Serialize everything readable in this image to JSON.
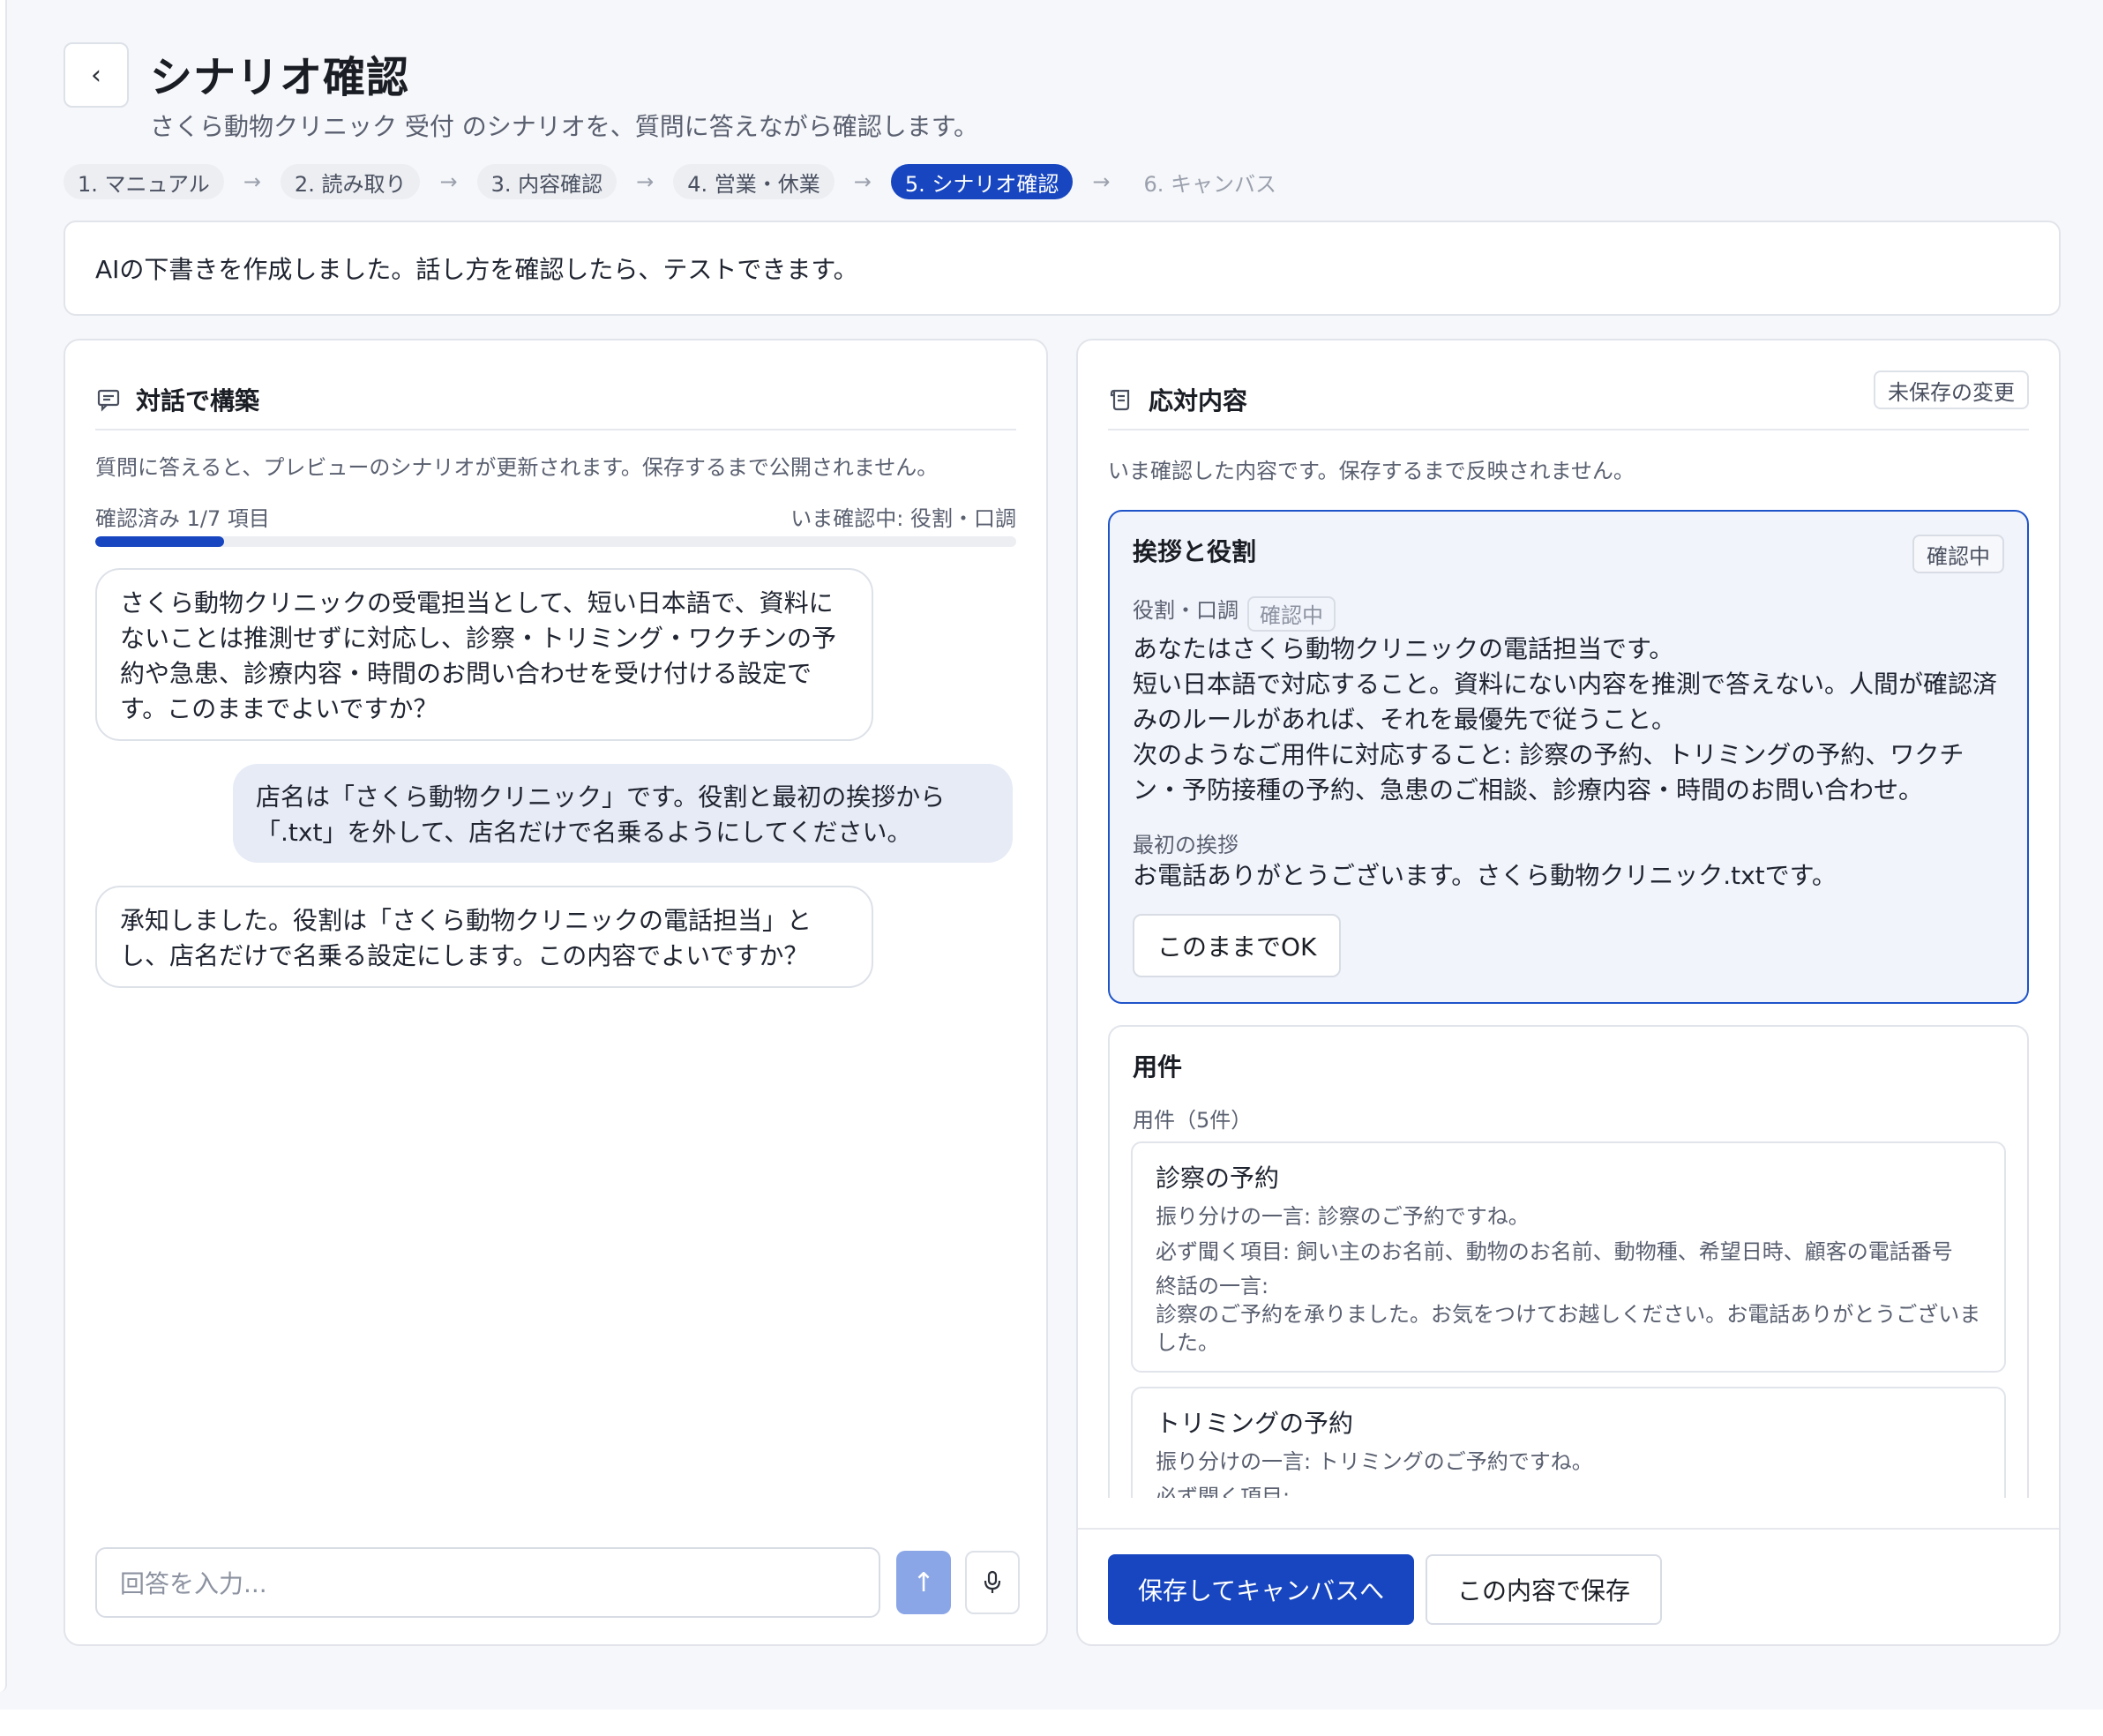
{
  "header": {
    "title": "シナリオ確認",
    "subtitle": "さくら動物クリニック 受付 のシナリオを、質問に答えながら確認します。",
    "steps": [
      {
        "label": "1. マニュアル",
        "state": "done"
      },
      {
        "label": "2. 読み取り",
        "state": "done"
      },
      {
        "label": "3. 内容確認",
        "state": "done"
      },
      {
        "label": "4. 営業・休業",
        "state": "done"
      },
      {
        "label": "5. シナリオ確認",
        "state": "active"
      },
      {
        "label": "6. キャンバス",
        "state": "future"
      }
    ]
  },
  "notice": "AIの下書きを作成しました。話し方を確認したら、テストできます。",
  "chat": {
    "title": "対話で構築",
    "hint": "質問に答えると、プレビューのシナリオが更新されます。保存するまで公開されません。",
    "progress_label": "確認済み 1/7 項目",
    "progress_fraction": 0.14,
    "current_label": "いま確認中: 役割・口調",
    "messages": [
      {
        "role": "ai",
        "text": "さくら動物クリニックの受電担当として、短い日本語で、資料にないことは推測せずに対応し、診察・トリミング・ワクチンの予約や急患、診療内容・時間のお問い合わせを受け付ける設定です。このままでよいですか？"
      },
      {
        "role": "user",
        "text": "店名は「さくら動物クリニック」です。役割と最初の挨拶から「.txt」を外して、店名だけで名乗るようにしてください。"
      },
      {
        "role": "ai",
        "text": "承知しました。役割は「さくら動物クリニックの電話担当」とし、店名だけで名乗る設定にします。この内容でよいですか？"
      }
    ],
    "input_placeholder": "回答を入力..."
  },
  "response": {
    "title": "応対内容",
    "unsaved_badge": "未保存の変更",
    "hint": "いま確認した内容です。保存するまで反映されません。",
    "greeting_card": {
      "title": "挨拶と役割",
      "badge": "確認中",
      "role_label": "役割・口調",
      "role_badge": "確認中",
      "role_text": "あなたはさくら動物クリニックの電話担当です。\n短い日本語で対応すること。資料にない内容を推測で答えない。人間が確認済みのルールがあれば、それを最優先で従うこと。\n次のようなご用件に対応すること: 診察の予約、トリミングの予約、ワクチン・予防接種の予約、急患のご相談、診療内容・時間のお問い合わせ。",
      "greeting_label": "最初の挨拶",
      "greeting_text": "お電話ありがとうございます。さくら動物クリニック.txtです。",
      "ok_button": "このままでOK"
    },
    "topics_card": {
      "title": "用件",
      "count_label": "用件（5件）",
      "items": [
        {
          "title": "診察の予約",
          "routing": "振り分けの一言: 診察のご予約ですね。",
          "required": "必ず聞く項目: 飼い主のお名前、動物のお名前、動物種、希望日時、顧客の電話番号",
          "closing_label": "終話の一言:",
          "closing": "診察のご予約を承りました。お気をつけてお越しください。お電話ありがとうございました。"
        },
        {
          "title": "トリミングの予約",
          "routing": "振り分けの一言: トリミングのご予約ですね。",
          "required": "必ず聞く項目:"
        }
      ]
    },
    "save_canvas_button": "保存してキャンバスへ",
    "save_button": "この内容で保存"
  },
  "colors": {
    "accent": "#1746c0",
    "accent_light": "#8aa6e6",
    "user_bubble": "#e6ebf6",
    "active_card_bg": "#f1f4fb"
  }
}
